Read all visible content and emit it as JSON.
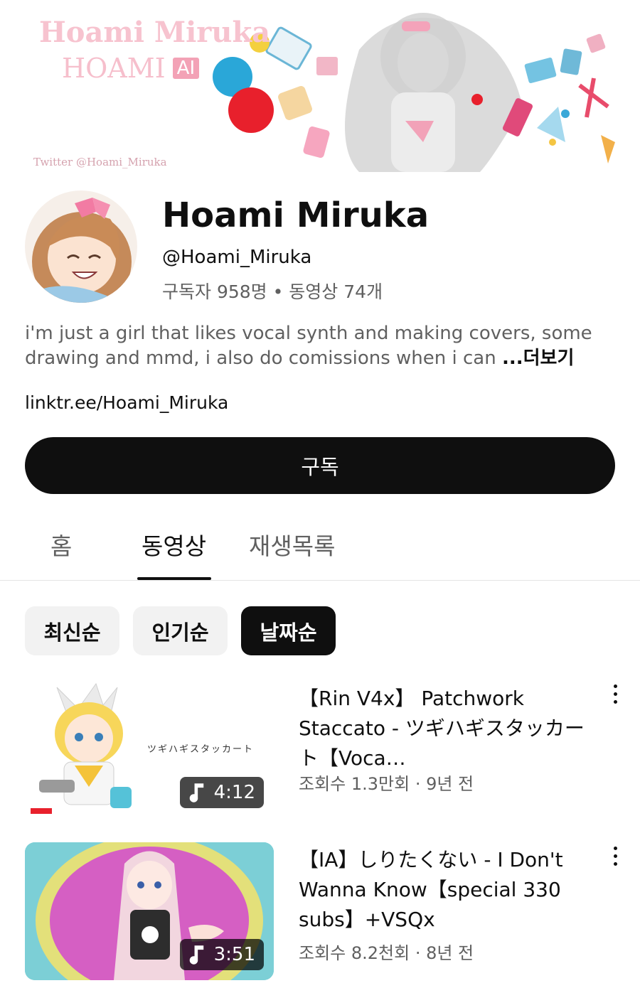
{
  "banner": {
    "name_text": "Hoami Miruka",
    "sub_text": "HOAMI",
    "ai_badge": "AI",
    "twitter_text": "Twitter @Hoami_Miruka"
  },
  "channel": {
    "name": "Hoami Miruka",
    "handle": "@Hoami_Miruka",
    "stats": "구독자 958명 • 동영상 74개",
    "description": "i'm just a girl that likes vocal synth and making covers, some drawing and mmd, i also do comissions when i can ",
    "more_label": "...더보기",
    "link": "linktr.ee/Hoami_Miruka",
    "subscribe_label": "구독"
  },
  "tabs": [
    {
      "label": "홈"
    },
    {
      "label": "동영상"
    },
    {
      "label": "재생목록"
    }
  ],
  "active_tab": "동영상",
  "chips": [
    {
      "label": "최신순"
    },
    {
      "label": "인기순"
    },
    {
      "label": "날짜순"
    }
  ],
  "selected_chip": "날짜순",
  "videos": [
    {
      "title": "【Rin V4x】 Patchwork Staccato - ツギハギスタッカート【Voca…",
      "meta": "조회수 1.3만회 · 9년 전",
      "duration": "4:12",
      "thumb_text": "ツギハギスタッカート"
    },
    {
      "title": "【IA】しりたくない - I Don't Wanna Know【special 330 subs】+VSQx",
      "meta": "조회수 8.2천회 · 8년 전",
      "duration": "3:51"
    }
  ],
  "colors": {
    "primary_text": "#0f0f0f",
    "secondary_text": "#606060",
    "chip_bg": "#f2f2f2",
    "banner_pink": "#f7c3cf"
  }
}
